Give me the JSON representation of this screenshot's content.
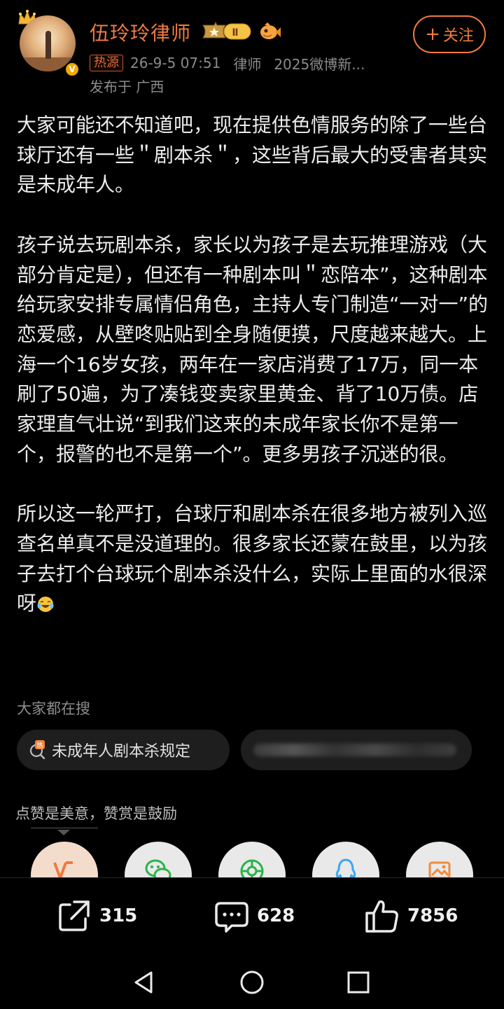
{
  "header": {
    "username": "伍玲玲律师",
    "rank_badge_text": "Ⅱ",
    "follow_label": "关注",
    "hot_tag": "热源",
    "datetime": "26-9-5 07:51",
    "role": "律师",
    "award": "2025微博新...",
    "location": "发布于 广西",
    "verified_mark": "V"
  },
  "post": {
    "paragraph_1": "大家可能还不知道吧，现在提供色情服务的除了一些台球厅还有一些＂剧本杀＂，这些背后最大的受害者其实是未成年人。",
    "paragraph_2": "孩子说去玩剧本杀，家长以为孩子是去玩推理游戏（大部分肯定是），但还有一种剧本叫＂恋陪本”，这种剧本给玩家安排专属情侣角色，主持人专门制造“一对一”的恋爱感，从壁咚贴贴到全身随便摸，尺度越来越大。上海一个16岁女孩，两年在一家店消费了17万，同一本刷了50遍，为了凑钱变卖家里黄金、背了10万债。店家理直气壮说“到我们这来的未成年家长你不是第一个，报警的也不是第一个”。更多男孩子沉迷的很。",
    "paragraph_3": "所以这一轮严打，台球厅和剧本杀在很多地方被列入巡查名单真不是没道理的。很多家长还蒙在鼓里，以为孩子去打个台球玩个剧本杀没什么，实际上里面的水很深呀",
    "emoji": "laugh-cry-emoji"
  },
  "search": {
    "title": "大家都在搜",
    "chips": [
      {
        "label": "未成年人剧本杀规定",
        "icon": "hot-search-icon"
      },
      {
        "label": "",
        "icon": "blurred"
      }
    ]
  },
  "reward": {
    "text": "点赞是美意，赞赏是鼓励",
    "targets": [
      "reward-v-icon",
      "wechat-icon",
      "moments-icon",
      "qq-icon",
      "save-image-icon"
    ]
  },
  "actions": {
    "repost_count": "315",
    "comment_count": "628",
    "like_count": "7856"
  },
  "colors": {
    "accent": "#f07b3f",
    "background": "#000000",
    "text": "#ececec",
    "muted": "#8b8b8b",
    "chip_bg": "#1e1e1e"
  }
}
